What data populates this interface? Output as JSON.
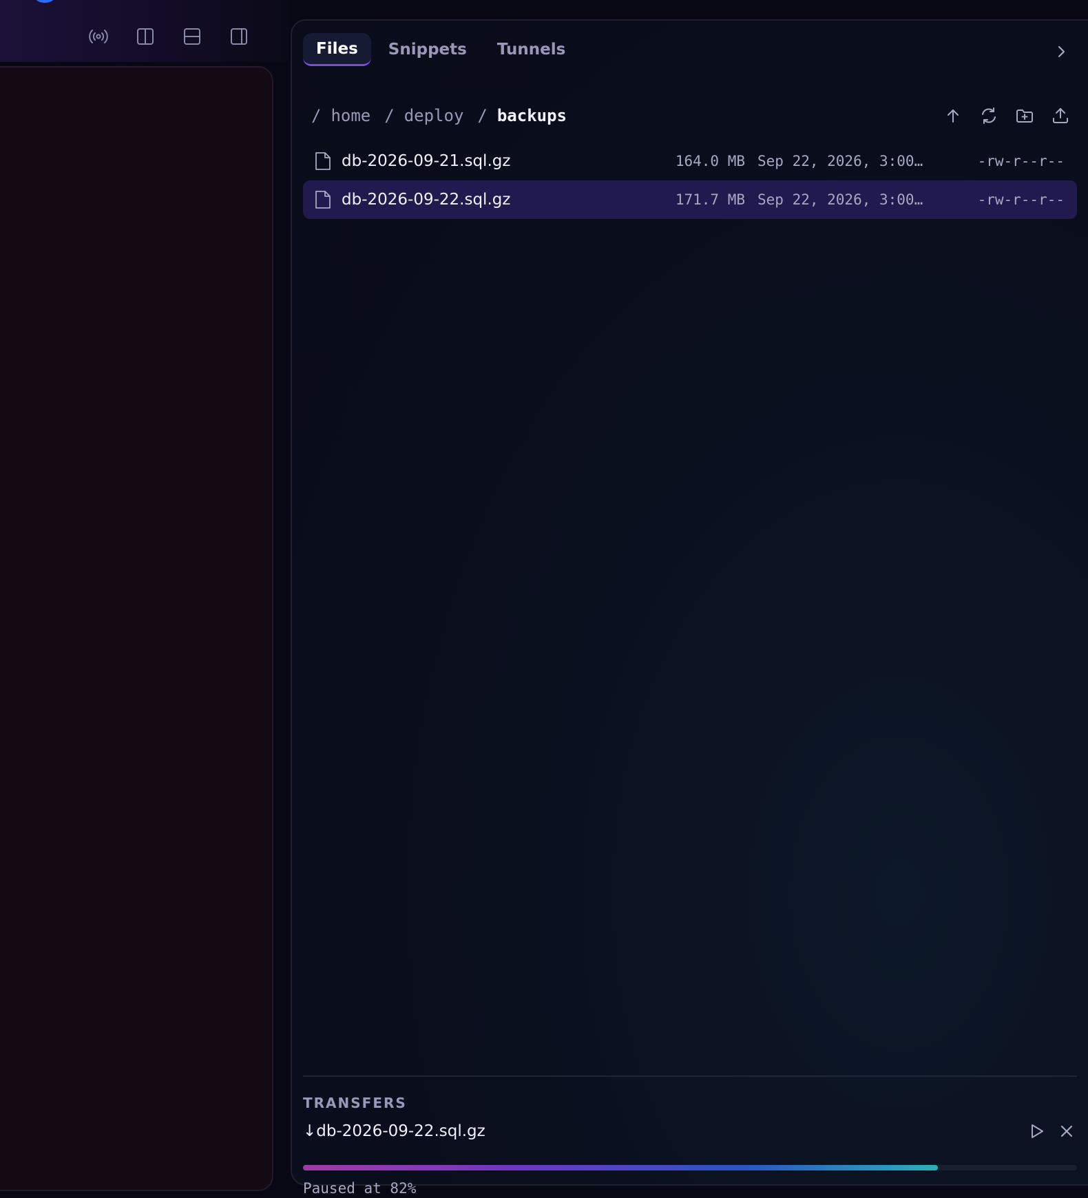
{
  "toolbar": {
    "icons": [
      "broadcast-icon",
      "split-vertical-icon",
      "split-horizontal-icon",
      "sidebar-right-icon"
    ]
  },
  "tabs": [
    {
      "label": "Files",
      "active": true
    },
    {
      "label": "Snippets",
      "active": false
    },
    {
      "label": "Tunnels",
      "active": false
    }
  ],
  "breadcrumb": {
    "root": "/",
    "separator": "/",
    "segments": [
      "home",
      "deploy",
      "backups"
    ]
  },
  "files": [
    {
      "name": "db-2026-09-21.sql.gz",
      "size": "164.0 MB",
      "modified": "Sep 22, 2026, 3:00…",
      "permissions": "-rw-r--r--",
      "selected": false
    },
    {
      "name": "db-2026-09-22.sql.gz",
      "size": "171.7 MB",
      "modified": "Sep 22, 2026, 3:00…",
      "permissions": "-rw-r--r--",
      "selected": true
    }
  ],
  "transfers": {
    "title": "TRANSFERS",
    "item": {
      "direction_glyph": "↓",
      "name": "db-2026-09-22.sql.gz",
      "progress": 0.82,
      "status": "Paused at 82%"
    }
  },
  "colors": {
    "accent": "#7b4ae8",
    "selected_row": "#201a4e",
    "panel_bg": "#0a0f1e",
    "terminal_bg": "#140a14"
  }
}
